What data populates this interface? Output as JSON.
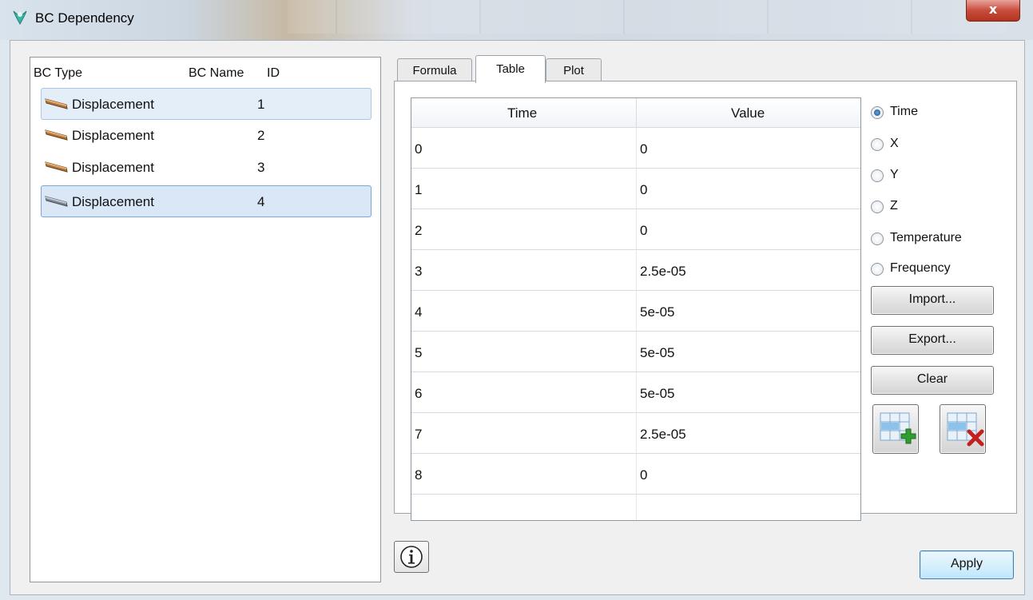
{
  "window": {
    "title": "BC Dependency",
    "close_label": "x"
  },
  "bc_list": {
    "headers": {
      "type": "BC Type",
      "name": "BC Name",
      "id": "ID"
    },
    "rows": [
      {
        "type": "Displacement",
        "id": "1",
        "icon": "displacement-icon",
        "state": "hover"
      },
      {
        "type": "Displacement",
        "id": "2",
        "icon": "displacement-icon",
        "state": "normal"
      },
      {
        "type": "Displacement",
        "id": "3",
        "icon": "displacement-icon",
        "state": "normal"
      },
      {
        "type": "Displacement",
        "id": "4",
        "icon": "displacement-icon",
        "state": "selected"
      }
    ]
  },
  "tabs": [
    {
      "label": "Formula",
      "active": false
    },
    {
      "label": "Table",
      "active": true
    },
    {
      "label": "Plot",
      "active": false
    }
  ],
  "table": {
    "columns": [
      "Time",
      "Value"
    ],
    "rows": [
      [
        "0",
        "0"
      ],
      [
        "1",
        "0"
      ],
      [
        "2",
        "0"
      ],
      [
        "3",
        "2.5e-05"
      ],
      [
        "4",
        "5e-05"
      ],
      [
        "5",
        "5e-05"
      ],
      [
        "6",
        "5e-05"
      ],
      [
        "7",
        "2.5e-05"
      ],
      [
        "8",
        "0"
      ]
    ]
  },
  "variables": [
    {
      "label": "Time",
      "checked": true
    },
    {
      "label": "X",
      "checked": false
    },
    {
      "label": "Y",
      "checked": false
    },
    {
      "label": "Z",
      "checked": false
    },
    {
      "label": "Temperature",
      "checked": false
    },
    {
      "label": "Frequency",
      "checked": false
    }
  ],
  "buttons": {
    "import": "Import...",
    "export": "Export...",
    "clear": "Clear",
    "apply": "Apply",
    "add_row_icon": "table-add-row-icon",
    "delete_row_icon": "table-delete-row-icon",
    "info_icon": "info-icon"
  },
  "colors": {
    "selection": "#d9e7f7",
    "accent_blue": "#3c7fb1",
    "close_red": "#c94c3d"
  }
}
